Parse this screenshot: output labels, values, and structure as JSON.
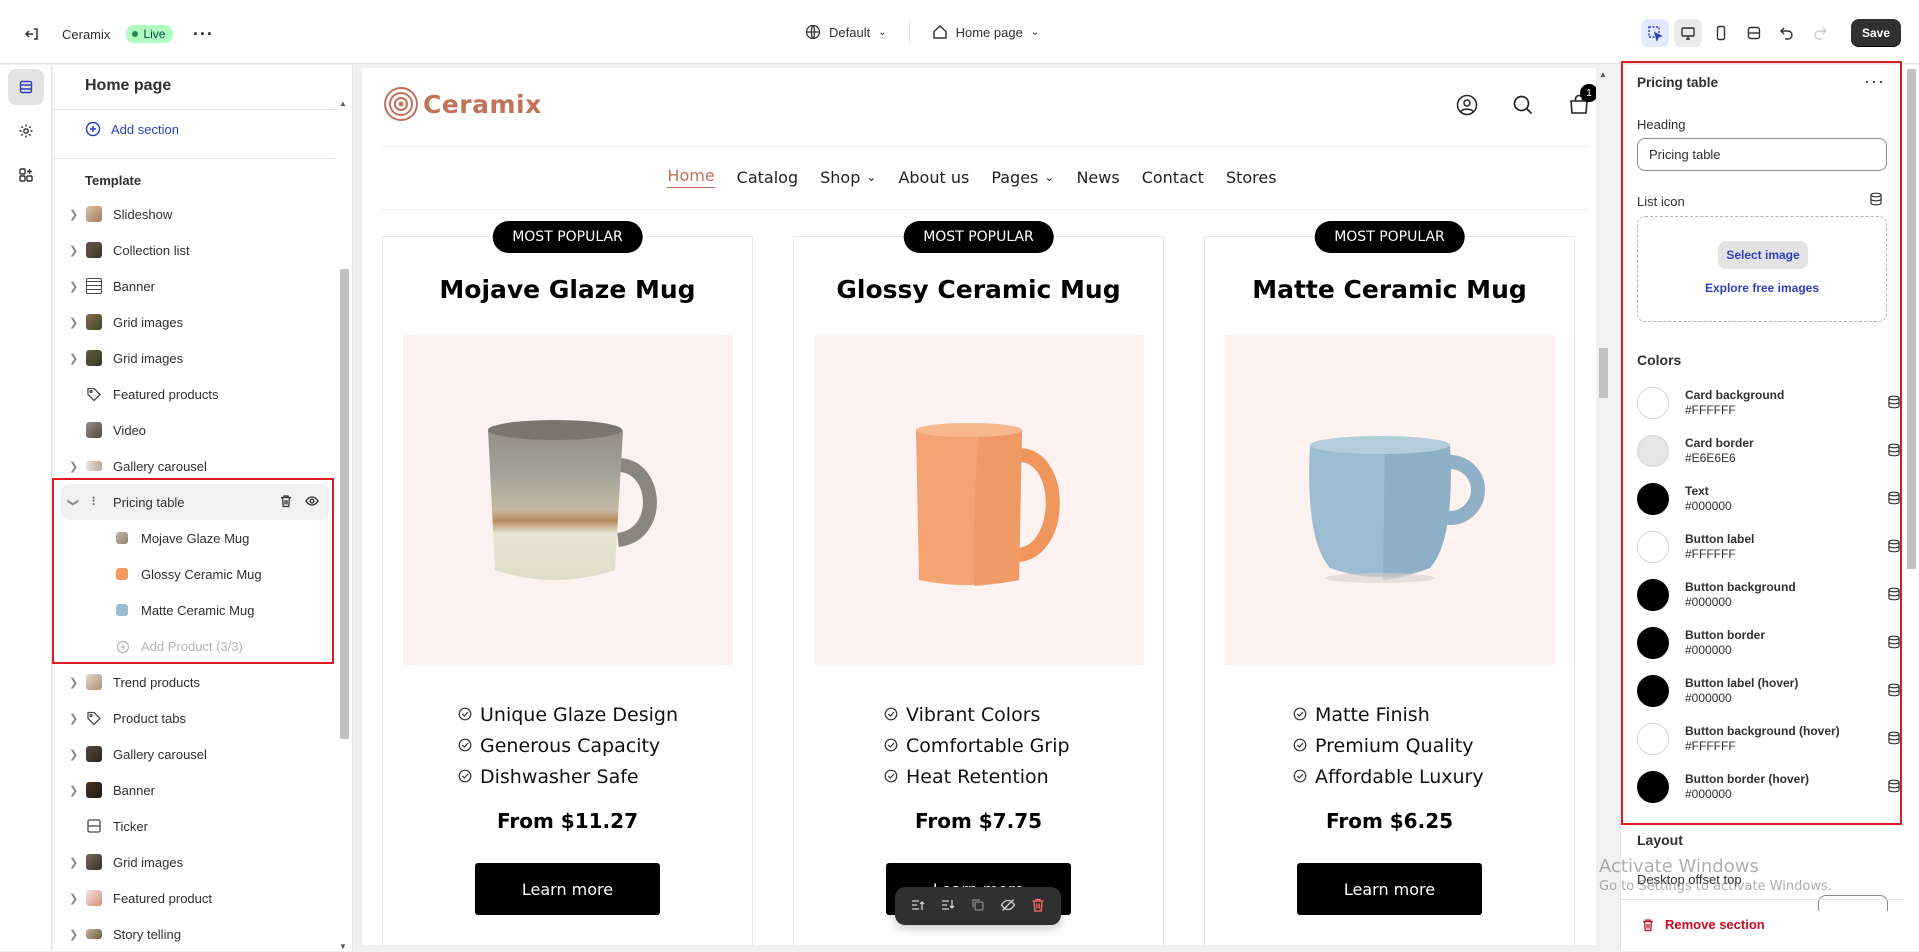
{
  "topbar": {
    "store_name": "Ceramix",
    "live_label": "Live",
    "theme_select": "Default",
    "page_select": "Home page",
    "save_label": "Save"
  },
  "sidebar": {
    "title": "Home page",
    "add_section": "Add section",
    "template_label": "Template",
    "items": [
      {
        "label": "Slideshow",
        "icon": "slideshow-thumb",
        "expandable": true
      },
      {
        "label": "Collection list",
        "icon": "collection-thumb",
        "expandable": true
      },
      {
        "label": "Banner",
        "icon": "banner-icon",
        "expandable": true
      },
      {
        "label": "Grid images",
        "icon": "grid-thumb",
        "expandable": true
      },
      {
        "label": "Grid images",
        "icon": "grid-thumb",
        "expandable": true
      },
      {
        "label": "Featured products",
        "icon": "tag-icon",
        "expandable": false
      },
      {
        "label": "Video",
        "icon": "video-thumb",
        "expandable": false
      },
      {
        "label": "Gallery carousel",
        "icon": "gallery-thumb",
        "expandable": true
      },
      {
        "label": "Pricing table",
        "icon": "grip-icon",
        "expandable": true,
        "selected": true
      },
      {
        "label": "Mojave Glaze Mug",
        "icon": "mug-thumb",
        "child": true
      },
      {
        "label": "Glossy Ceramic Mug",
        "icon": "mug-thumb",
        "child": true
      },
      {
        "label": "Matte Ceramic Mug",
        "icon": "mug-thumb",
        "child": true
      },
      {
        "label": "Add Product (3/3)",
        "icon": "plus-circle-icon",
        "child": true,
        "disabled": true
      },
      {
        "label": "Trend products",
        "icon": "trend-thumb",
        "expandable": true
      },
      {
        "label": "Product tabs",
        "icon": "tag-icon",
        "expandable": true
      },
      {
        "label": "Gallery carousel",
        "icon": "gallery-thumb",
        "expandable": true
      },
      {
        "label": "Banner",
        "icon": "banner-thumb",
        "expandable": true
      },
      {
        "label": "Ticker",
        "icon": "ticker-icon",
        "expandable": false
      },
      {
        "label": "Grid images",
        "icon": "grid-thumb",
        "expandable": true
      },
      {
        "label": "Featured product",
        "icon": "featured-thumb",
        "expandable": true
      },
      {
        "label": "Story telling",
        "icon": "story-thumb",
        "expandable": true
      }
    ]
  },
  "preview": {
    "logo_text": "Ceramix",
    "cart_count": "1",
    "nav": [
      "Home",
      "Catalog",
      "Shop",
      "About us",
      "Pages",
      "News",
      "Contact",
      "Stores"
    ],
    "cards": [
      {
        "badge": "MOST POPULAR",
        "title": "Mojave Glaze Mug",
        "features": [
          "Unique Glaze Design",
          "Generous Capacity",
          "Dishwasher Safe"
        ],
        "price": "From $11.27",
        "button": "Learn more"
      },
      {
        "badge": "MOST POPULAR",
        "title": "Glossy Ceramic Mug",
        "features": [
          "Vibrant Colors",
          "Comfortable Grip",
          "Heat Retention"
        ],
        "price": "From $7.75",
        "button": "Learn more"
      },
      {
        "badge": "MOST POPULAR",
        "title": "Matte Ceramic Mug",
        "features": [
          "Matte Finish",
          "Premium Quality",
          "Affordable Luxury"
        ],
        "price": "From $6.25",
        "button": "Learn more"
      }
    ]
  },
  "settings": {
    "title": "Pricing table",
    "heading_label": "Heading",
    "heading_value": "Pricing table",
    "list_icon_label": "List icon",
    "select_image": "Select image",
    "explore_images": "Explore free images",
    "colors_title": "Colors",
    "colors": [
      {
        "name": "Card background",
        "hex": "#FFFFFF"
      },
      {
        "name": "Card border",
        "hex": "#E6E6E6"
      },
      {
        "name": "Text",
        "hex": "#000000"
      },
      {
        "name": "Button label",
        "hex": "#FFFFFF"
      },
      {
        "name": "Button background",
        "hex": "#000000"
      },
      {
        "name": "Button border",
        "hex": "#000000"
      },
      {
        "name": "Button label (hover)",
        "hex": "#000000"
      },
      {
        "name": "Button background (hover)",
        "hex": "#FFFFFF"
      },
      {
        "name": "Button border (hover)",
        "hex": "#000000"
      }
    ],
    "layout_title": "Layout",
    "offset_label": "Desktop offset top",
    "remove_section": "Remove section"
  },
  "watermark": {
    "line1": "Activate Windows",
    "line2": "Go to Settings to activate Windows."
  }
}
